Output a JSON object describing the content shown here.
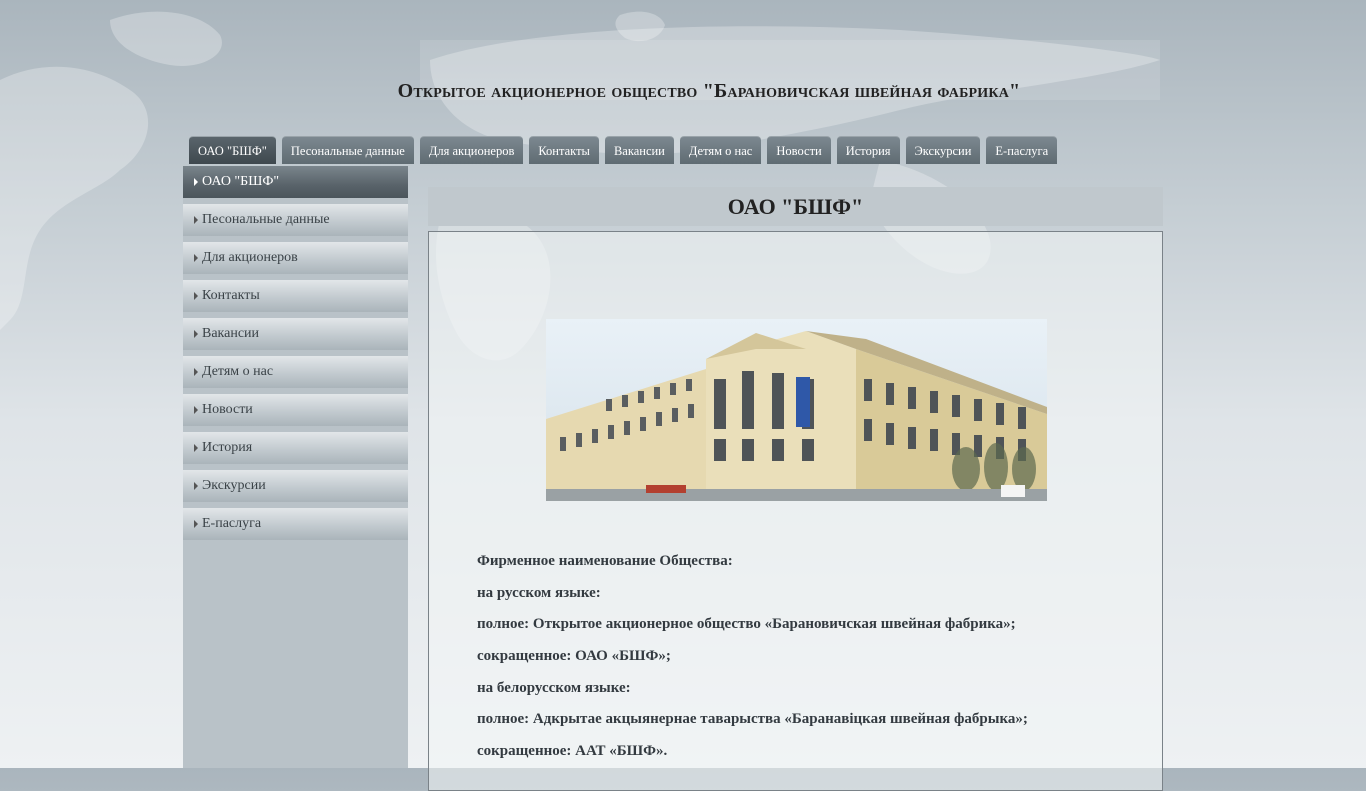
{
  "site": {
    "title": "Открытое акционерное общество  \"Барановичская швейная фабрика\""
  },
  "topnav": [
    {
      "label": "ОАО \"БШФ\"",
      "active": true
    },
    {
      "label": "Песональные данные"
    },
    {
      "label": "Для акционеров"
    },
    {
      "label": "Контакты"
    },
    {
      "label": "Вакансии"
    },
    {
      "label": "Детям о нас"
    },
    {
      "label": "Новости"
    },
    {
      "label": "История"
    },
    {
      "label": "Экскурсии"
    },
    {
      "label": "Е-паслуга"
    }
  ],
  "sidebar": [
    {
      "label": "ОАО \"БШФ\"",
      "active": true
    },
    {
      "label": "Песональные данные"
    },
    {
      "label": "Для акционеров"
    },
    {
      "label": "Контакты"
    },
    {
      "label": "Вакансии"
    },
    {
      "label": "Детям о нас"
    },
    {
      "label": "Новости"
    },
    {
      "label": "История"
    },
    {
      "label": "Экскурсии"
    },
    {
      "label": "Е-паслуга"
    }
  ],
  "content": {
    "heading": "ОАО \"БШФ\"",
    "lines": [
      "Фирменное наименование Общества:",
      "на русском языке:",
      "полное: Открытое акционерное общество «Барановичская швейная фабрика»;",
      "сокращенное: ОАО «БШФ»;",
      "на белорусском языке:",
      "полное: Адкрытае акцыянернае таварыства «Баранавіцкая швейная фабрыка»;",
      "сокращенное: ААТ «БШФ»."
    ]
  },
  "colors": {
    "nav_tab": "#66727a",
    "nav_tab_active": "#4a545a",
    "sidebar_bg": "#b9c2c8",
    "heading_bar": "#c0c8cd"
  }
}
